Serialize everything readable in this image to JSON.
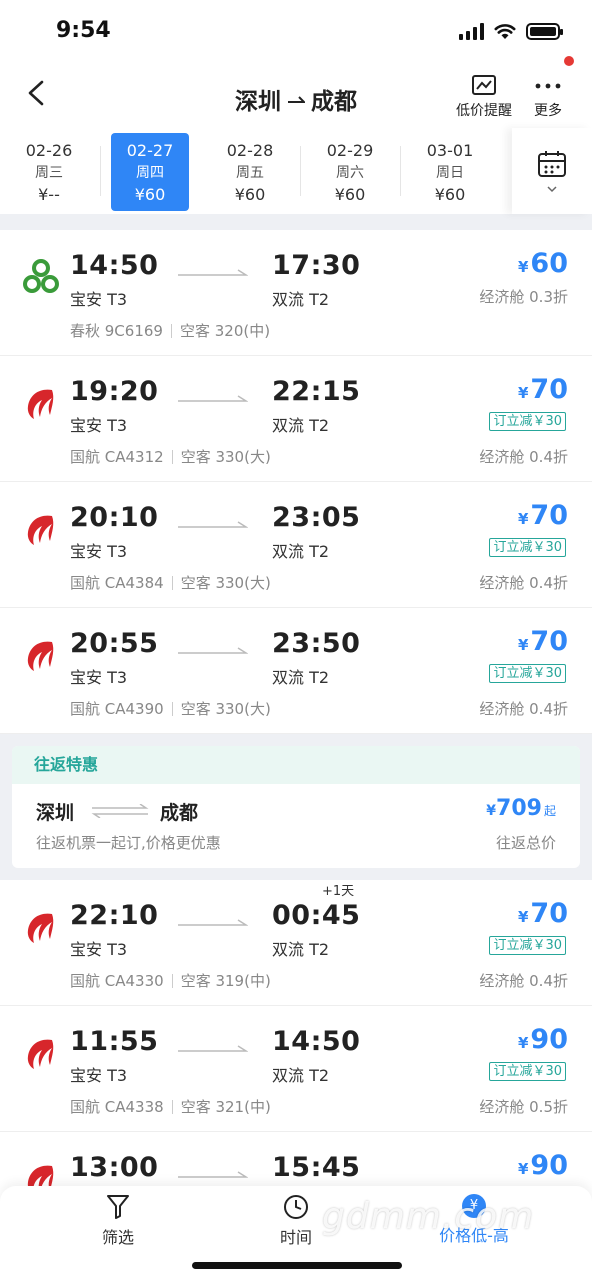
{
  "status_bar": {
    "time": "9:54"
  },
  "nav": {
    "from": "深圳",
    "to": "成都",
    "price_alert_label": "低价提醒",
    "more_label": "更多"
  },
  "dates": [
    {
      "date": "02-26",
      "weekday": "周三",
      "price": "¥--",
      "active": false
    },
    {
      "date": "02-27",
      "weekday": "周四",
      "price": "¥60",
      "active": true
    },
    {
      "date": "02-28",
      "weekday": "周五",
      "price": "¥60",
      "active": false
    },
    {
      "date": "02-29",
      "weekday": "周六",
      "price": "¥60",
      "active": false
    },
    {
      "date": "03-01",
      "weekday": "周日",
      "price": "¥60",
      "active": false
    }
  ],
  "flights": [
    {
      "dep_time": "14:50",
      "dep_airport": "宝安 T3",
      "arr_time": "17:30",
      "arr_airport": "双流 T2",
      "plus_day": "",
      "airline": "春秋 9C6169",
      "aircraft": "空客 320(中)",
      "currency": "¥",
      "price": "60",
      "discount_tag": "",
      "cabin": "经济舱 0.3折",
      "logo": "spring-airlines-logo-icon"
    },
    {
      "dep_time": "19:20",
      "dep_airport": "宝安 T3",
      "arr_time": "22:15",
      "arr_airport": "双流 T2",
      "plus_day": "",
      "airline": "国航 CA4312",
      "aircraft": "空客 330(大)",
      "currency": "¥",
      "price": "70",
      "discount_tag": "订立减￥30",
      "cabin": "经济舱 0.4折",
      "logo": "air-china-logo-icon"
    },
    {
      "dep_time": "20:10",
      "dep_airport": "宝安 T3",
      "arr_time": "23:05",
      "arr_airport": "双流 T2",
      "plus_day": "",
      "airline": "国航 CA4384",
      "aircraft": "空客 330(大)",
      "currency": "¥",
      "price": "70",
      "discount_tag": "订立减￥30",
      "cabin": "经济舱 0.4折",
      "logo": "air-china-logo-icon"
    },
    {
      "dep_time": "20:55",
      "dep_airport": "宝安 T3",
      "arr_time": "23:50",
      "arr_airport": "双流 T2",
      "plus_day": "",
      "airline": "国航 CA4390",
      "aircraft": "空客 330(大)",
      "currency": "¥",
      "price": "70",
      "discount_tag": "订立减￥30",
      "cabin": "经济舱 0.4折",
      "logo": "air-china-logo-icon"
    }
  ],
  "promo": {
    "heading": "往返特惠",
    "from": "深圳",
    "to": "成都",
    "subtitle": "往返机票一起订,价格更优惠",
    "currency": "¥",
    "price": "709",
    "price_suffix": "起",
    "total_label": "往返总价"
  },
  "flights_more": [
    {
      "dep_time": "22:10",
      "dep_airport": "宝安 T3",
      "arr_time": "00:45",
      "arr_airport": "双流 T2",
      "plus_day": "+1天",
      "airline": "国航 CA4330",
      "aircraft": "空客 319(中)",
      "currency": "¥",
      "price": "70",
      "discount_tag": "订立减￥30",
      "cabin": "经济舱 0.4折",
      "logo": "air-china-logo-icon"
    },
    {
      "dep_time": "11:55",
      "dep_airport": "宝安 T3",
      "arr_time": "14:50",
      "arr_airport": "双流 T2",
      "plus_day": "",
      "airline": "国航 CA4338",
      "aircraft": "空客 321(中)",
      "currency": "¥",
      "price": "90",
      "discount_tag": "订立减￥30",
      "cabin": "经济舱 0.5折",
      "logo": "air-china-logo-icon"
    },
    {
      "dep_time": "13:00",
      "dep_airport": "",
      "arr_time": "15:45",
      "arr_airport": "",
      "plus_day": "",
      "airline": "",
      "aircraft": "",
      "currency": "¥",
      "price": "90",
      "discount_tag": "",
      "cabin": "",
      "logo": "air-china-logo-icon"
    }
  ],
  "bottom_tabs": {
    "filter_label": "筛选",
    "time_label": "时间",
    "sort_label": "价格低-高",
    "sort_badge": "¥"
  },
  "watermark": "gdmm.com",
  "colors": {
    "accent": "#2f86f6",
    "discount": "#26a69a",
    "air_china_red": "#d7262b",
    "spring_green": "#3a9b3a"
  }
}
